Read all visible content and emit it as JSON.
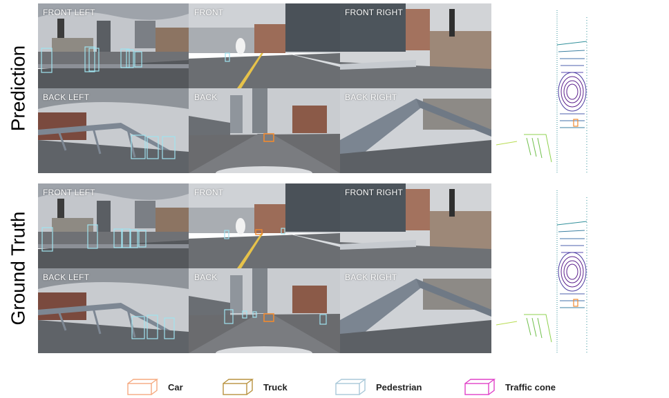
{
  "rows": [
    {
      "label": "Prediction"
    },
    {
      "label": "Ground Truth"
    }
  ],
  "cameras": [
    "FRONT LEFT",
    "FRONT",
    "FRONT RIGHT",
    "BACK LEFT",
    "BACK",
    "BACK RIGHT"
  ],
  "legend": [
    {
      "label": "Car",
      "color": "#f5a97f"
    },
    {
      "label": "Truck",
      "color": "#b8923e"
    },
    {
      "label": "Pedestrian",
      "color": "#a8c8d8"
    },
    {
      "label": "Traffic cone",
      "color": "#e040c8"
    }
  ],
  "colors": {
    "pedestrian_box": "#9fe3f0",
    "car_box": "#f08a30",
    "sky": "#c9ccd1",
    "road": "#6d6f72",
    "lidar_near": "#5a1e8c",
    "lidar_mid": "#2f8f9a",
    "lidar_far": "#8fd14f"
  }
}
